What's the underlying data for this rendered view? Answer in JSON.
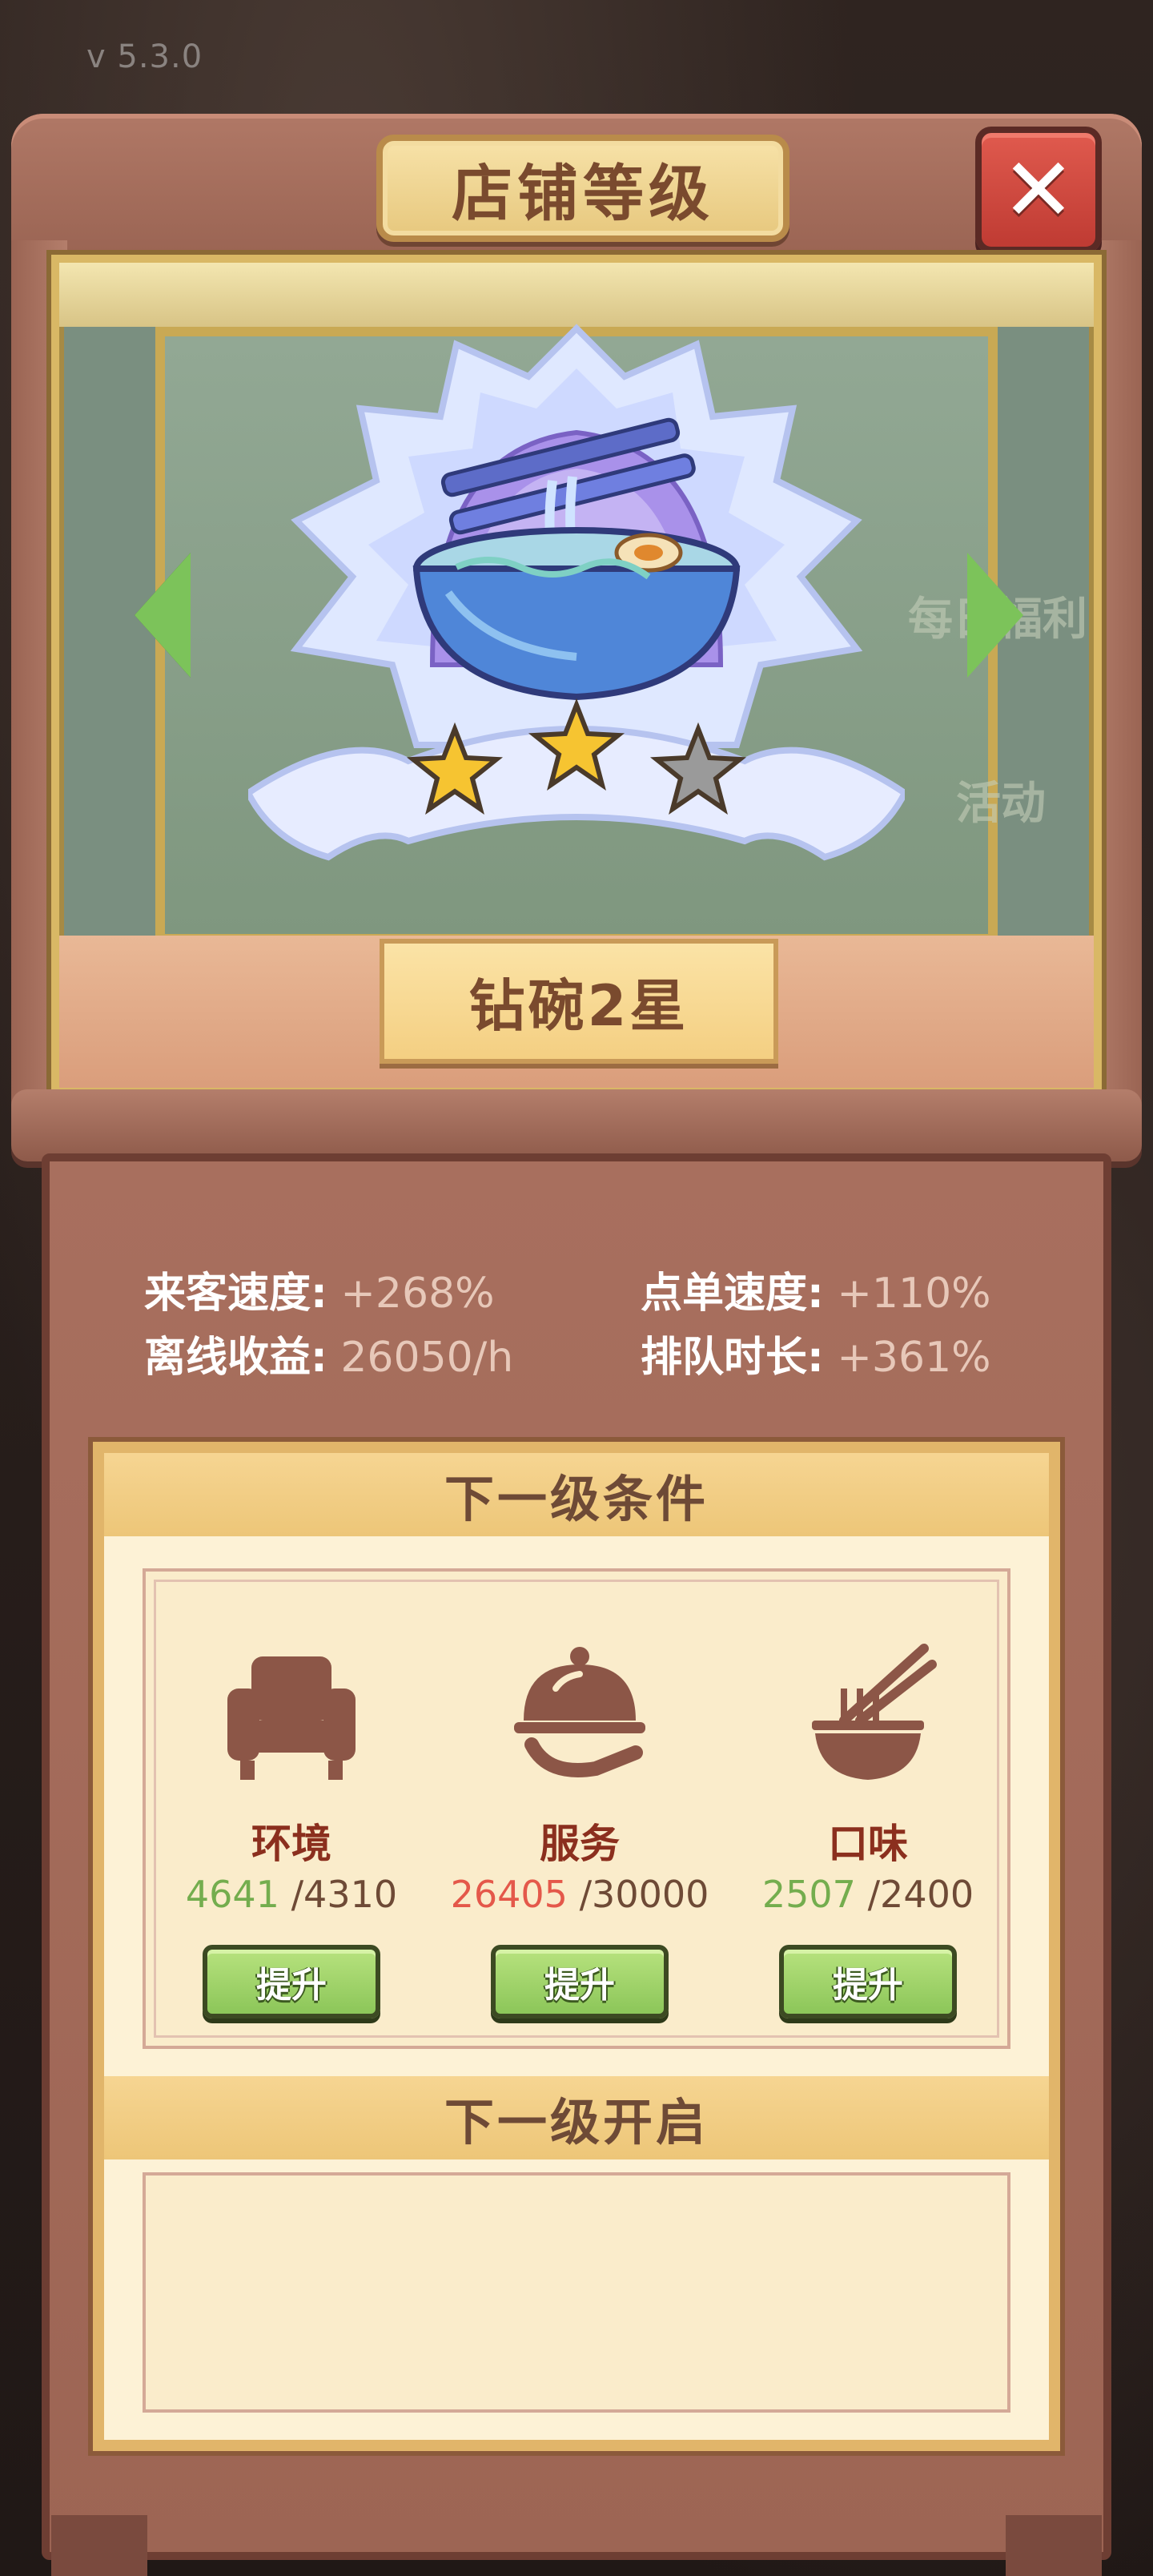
{
  "version": "v 5.3.0",
  "title": "店铺等级",
  "close_icon": "close-icon",
  "background_watermark": [
    "每日福利",
    "活动"
  ],
  "emblem": {
    "name": "noodle-bowl-diamond-emblem",
    "stars_total": 3,
    "stars_filled": 2
  },
  "rank_label": "钻碗2星",
  "stats": [
    {
      "label": "来客速度:",
      "value": "+268%"
    },
    {
      "label": "点单速度:",
      "value": "+110%"
    },
    {
      "label": "离线收益:",
      "value": "26050/h"
    },
    {
      "label": "排队时长:",
      "value": "+361%"
    }
  ],
  "next_conditions": {
    "header": "下一级条件",
    "items": [
      {
        "name": "环境",
        "icon": "armchair-icon",
        "current": "4641",
        "target": "/4310",
        "met": true,
        "button": "提升"
      },
      {
        "name": "服务",
        "icon": "serving-cloche-icon",
        "current": "26405",
        "target": "/30000",
        "met": false,
        "button": "提升"
      },
      {
        "name": "口味",
        "icon": "bowl-chopsticks-icon",
        "current": "2507",
        "target": "/2400",
        "met": true,
        "button": "提升"
      }
    ]
  },
  "next_unlock": {
    "header": "下一级开启"
  },
  "colors": {
    "met": "#74ad4e",
    "unmet": "#e4584a",
    "button_green": "#8cc659",
    "close_red": "#d24a40"
  }
}
